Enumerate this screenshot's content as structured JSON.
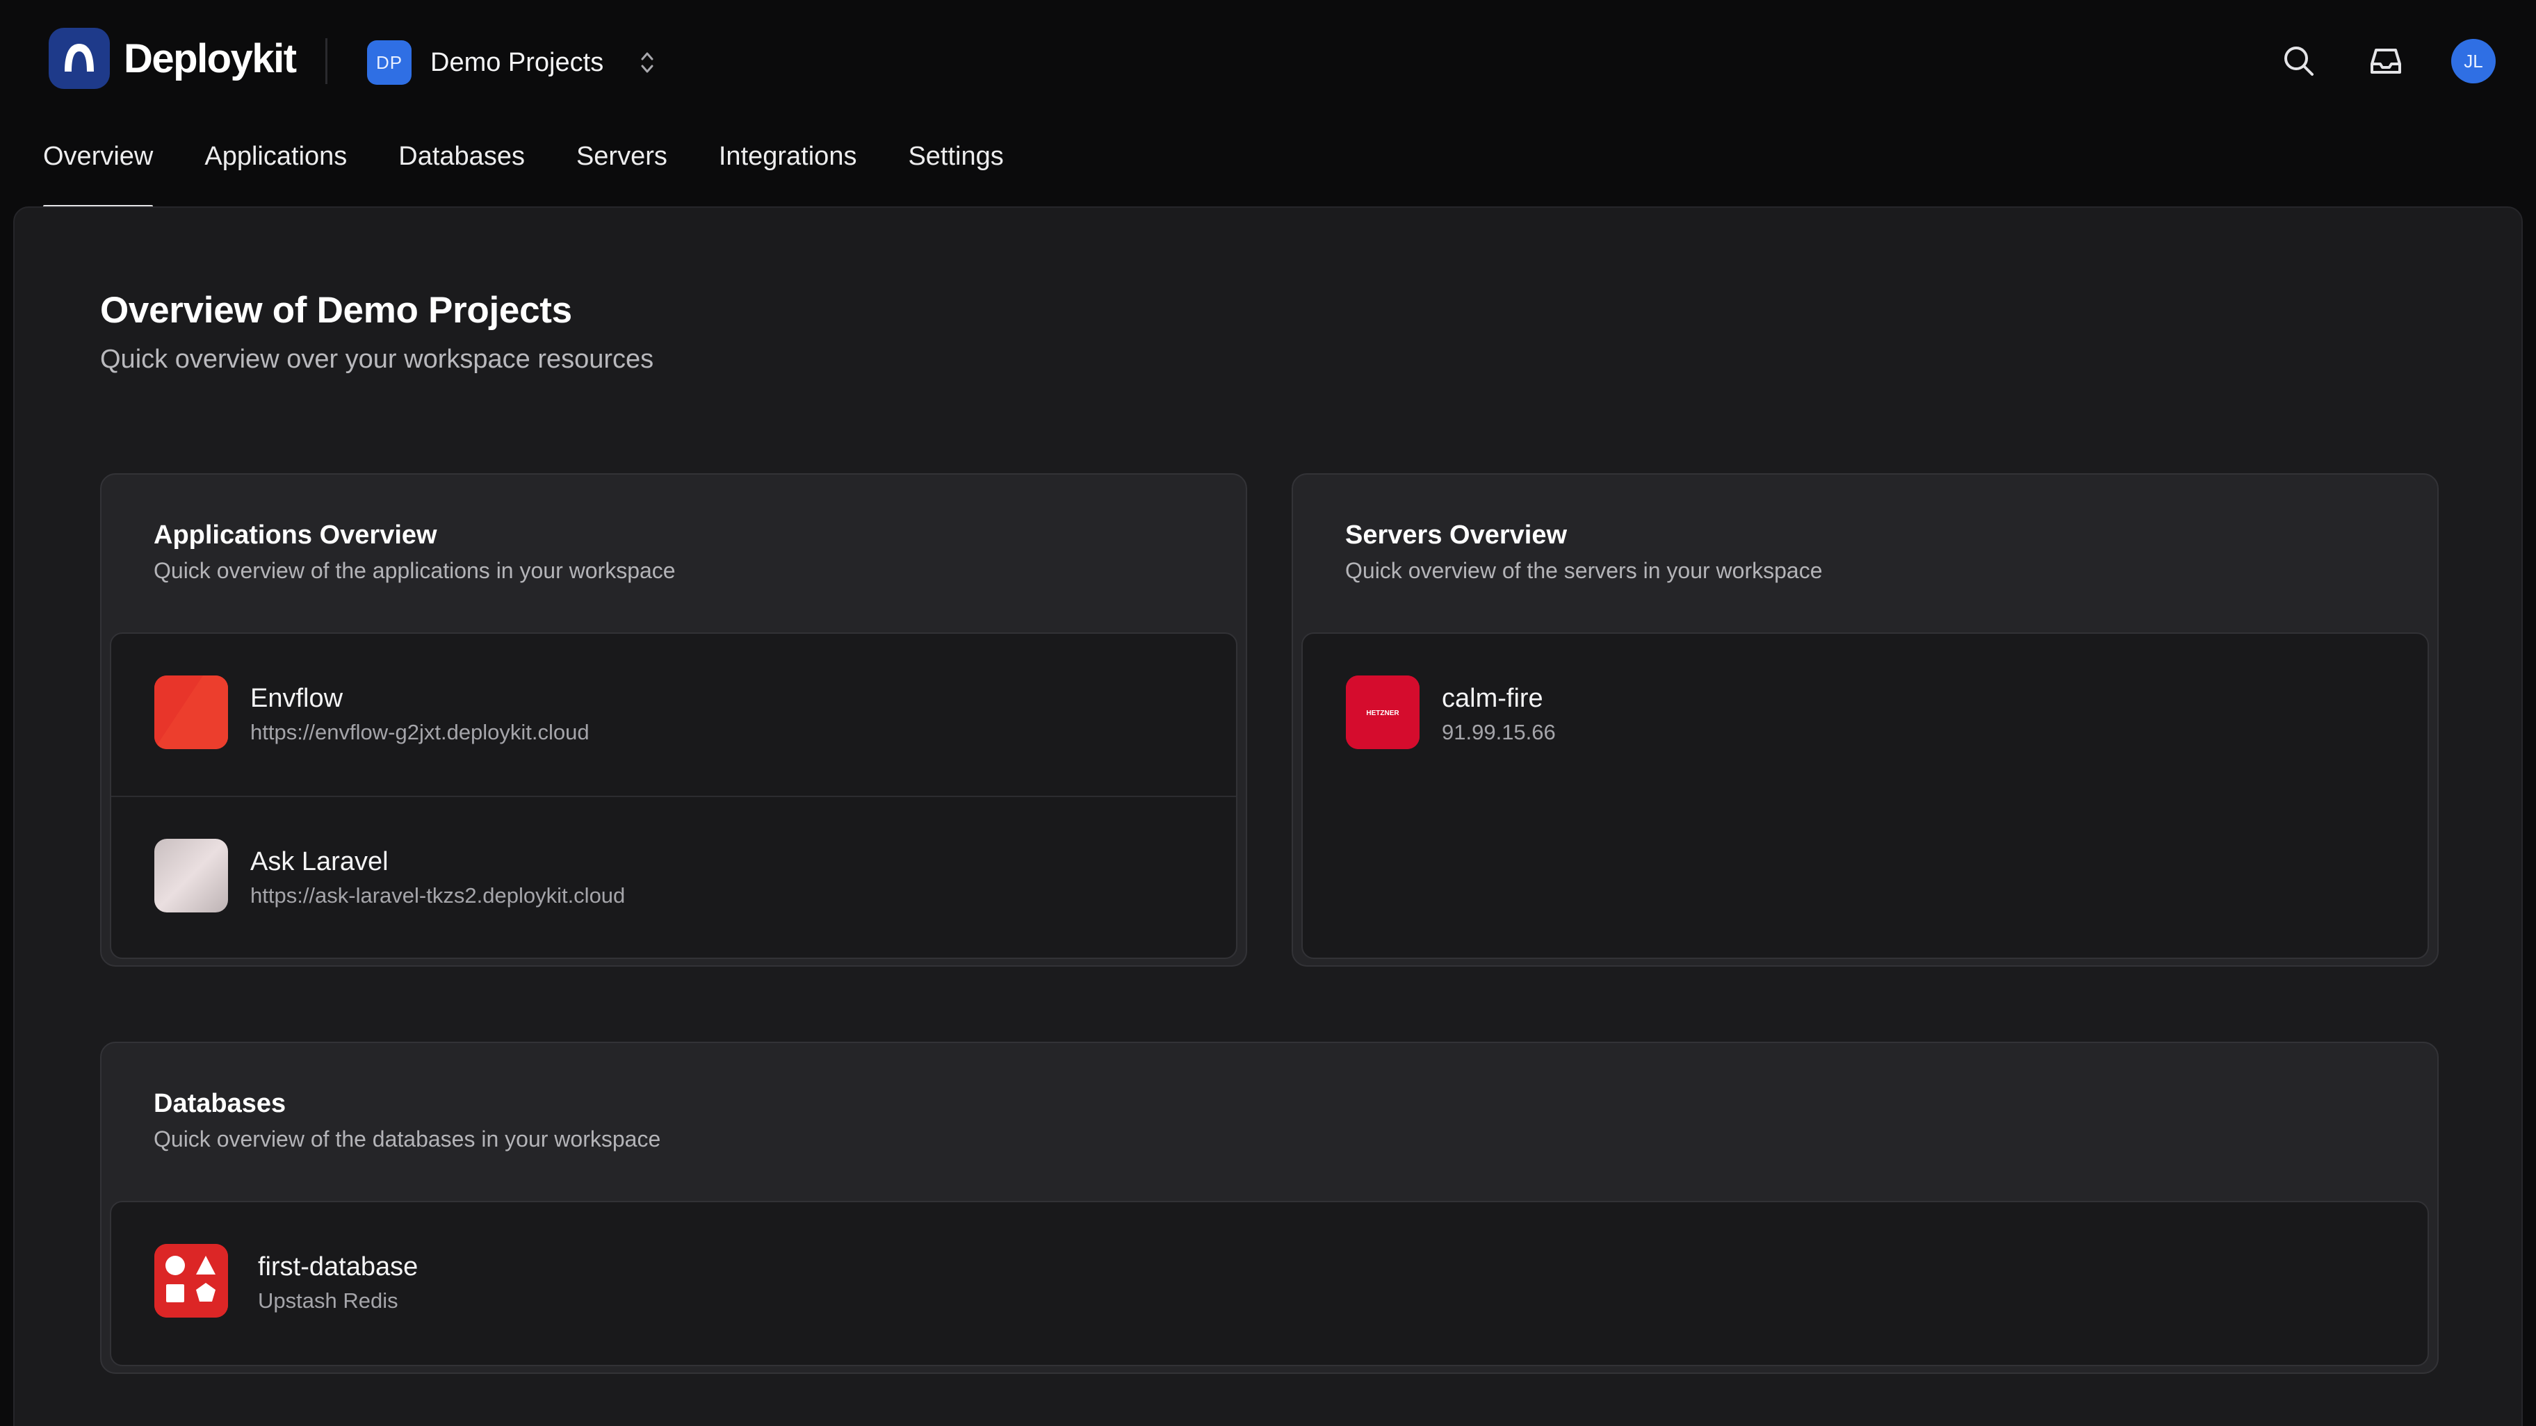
{
  "brand": {
    "name": "Deploykit"
  },
  "workspace": {
    "initials": "DP",
    "name": "Demo Projects"
  },
  "user": {
    "initials": "JL"
  },
  "tabs": [
    {
      "label": "Overview",
      "active": true
    },
    {
      "label": "Applications",
      "active": false
    },
    {
      "label": "Databases",
      "active": false
    },
    {
      "label": "Servers",
      "active": false
    },
    {
      "label": "Integrations",
      "active": false
    },
    {
      "label": "Settings",
      "active": false
    }
  ],
  "page": {
    "title": "Overview of Demo Projects",
    "subtitle": "Quick overview over your workspace resources"
  },
  "applications": {
    "title": "Applications Overview",
    "subtitle": "Quick overview of the applications in your workspace",
    "items": [
      {
        "name": "Envflow",
        "url": "https://envflow-g2jxt.deploykit.cloud",
        "icon": "envflow-app-icon",
        "color": "#e8352a"
      },
      {
        "name": "Ask Laravel",
        "url": "https://ask-laravel-tkzs2.deploykit.cloud",
        "icon": "ask-laravel-app-icon",
        "color": "#d9cfd0"
      }
    ]
  },
  "servers": {
    "title": "Servers Overview",
    "subtitle": "Quick overview of the servers in your workspace",
    "items": [
      {
        "name": "calm-fire",
        "ip": "91.99.15.66",
        "provider_logo_text": "HETZNER",
        "icon": "hetzner-server-icon",
        "color": "#d50c2d"
      }
    ]
  },
  "databases": {
    "title": "Databases",
    "subtitle": "Quick overview of the databases in your workspace",
    "items": [
      {
        "name": "first-database",
        "type": "Upstash Redis",
        "icon": "upstash-redis-icon",
        "color": "#dc2626"
      }
    ]
  },
  "colors": {
    "accent_blue": "#2f6fe4",
    "brand_navy": "#1e3a8a",
    "background": "#0b0b0c",
    "panel": "#1b1b1d"
  },
  "icons": [
    "deploykit-logo",
    "workspace-switch-icon",
    "search-icon",
    "inbox-icon"
  ]
}
